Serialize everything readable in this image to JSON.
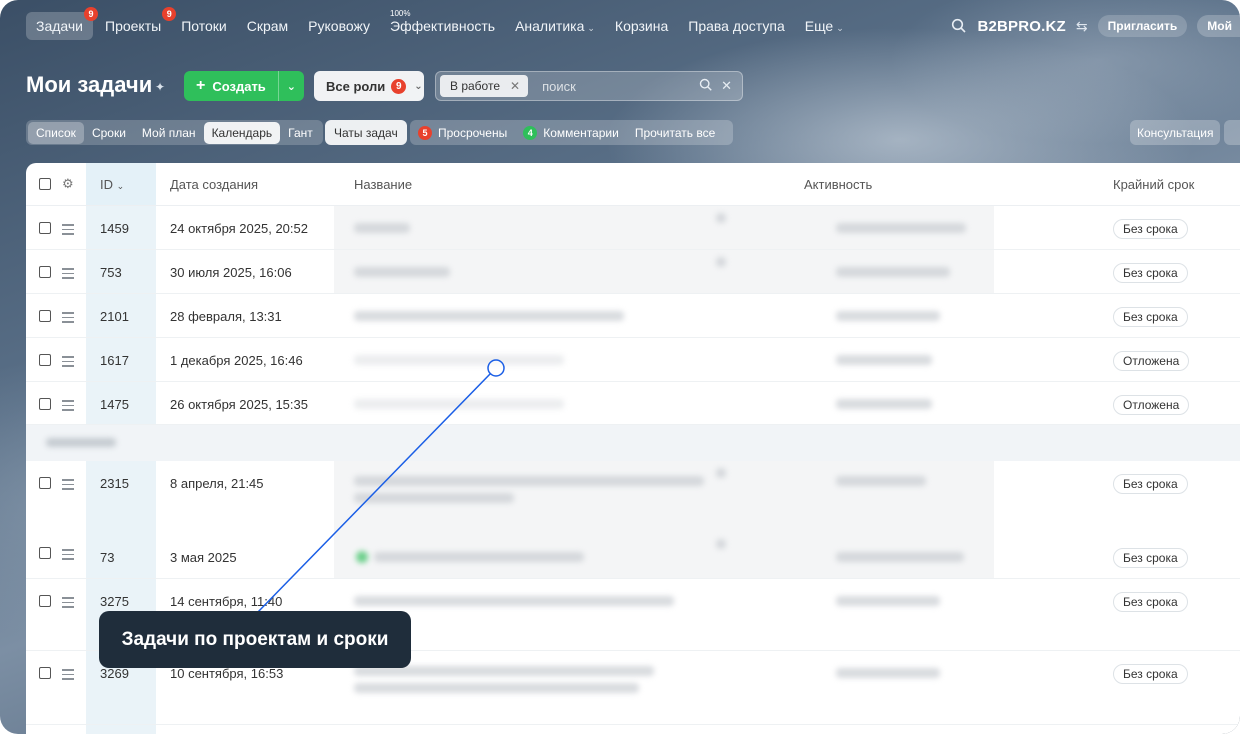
{
  "nav": {
    "items": [
      {
        "label": "Задачи",
        "badge": "9",
        "active": true
      },
      {
        "label": "Проекты",
        "badge": "9"
      },
      {
        "label": "Потоки"
      },
      {
        "label": "Скрам"
      },
      {
        "label": "Руковожу"
      },
      {
        "label": "Эффективность",
        "sup": "100%"
      },
      {
        "label": "Аналитика",
        "dropdown": true
      },
      {
        "label": "Корзина"
      },
      {
        "label": "Права доступа"
      },
      {
        "label": "Еще",
        "dropdown": true
      }
    ],
    "brand": "B2BPRO.KZ",
    "invite": "Пригласить",
    "mine": "Мой"
  },
  "header": {
    "title": "Мои задачи",
    "create_label": "Создать",
    "roles_label": "Все роли",
    "roles_count": "9",
    "filter_chip": "В работе",
    "search_placeholder": "поиск"
  },
  "views": {
    "tabs": [
      "Список",
      "Сроки",
      "Мой план",
      "Календарь",
      "Гант"
    ],
    "chats": "Чаты задач",
    "overdue_count": "5",
    "overdue_label": "Просрочены",
    "comments_count": "4",
    "comments_label": "Комментарии",
    "read_all": "Прочитать все",
    "consult": "Консультация"
  },
  "table": {
    "columns": {
      "id": "ID",
      "created": "Дата создания",
      "name": "Название",
      "activity": "Активность",
      "deadline": "Крайний срок"
    },
    "rows": [
      {
        "id": "1459",
        "created": "24 октября 2025, 20:52",
        "deadline": "Без срока"
      },
      {
        "id": "753",
        "created": "30 июля 2025, 16:06",
        "deadline": "Без срока"
      },
      {
        "id": "2101",
        "created": "28 февраля, 13:31",
        "deadline": "Без срока"
      },
      {
        "id": "1617",
        "created": "1 декабря 2025, 16:46",
        "deadline": "Отложена"
      },
      {
        "id": "1475",
        "created": "26 октября 2025, 15:35",
        "deadline": "Отложена"
      },
      {
        "id": "2315",
        "created": "8 апреля, 21:45",
        "deadline": "Без срока"
      },
      {
        "id": "73",
        "created": "3 мая 2025",
        "deadline": "Без срока"
      },
      {
        "id": "3275",
        "created": "14 сентября, 11:40",
        "deadline": "Без срока"
      },
      {
        "id": "3269",
        "created": "10 сентября, 16:53",
        "deadline": "Без срока"
      }
    ]
  },
  "annotation": {
    "text": "Задачи по проектам и сроки"
  },
  "colors": {
    "accent_green": "#2fbf5b",
    "badge_red": "#e8412d",
    "annotation_blue": "#1a5ee6",
    "tooltip_bg": "#1f2d3b"
  }
}
